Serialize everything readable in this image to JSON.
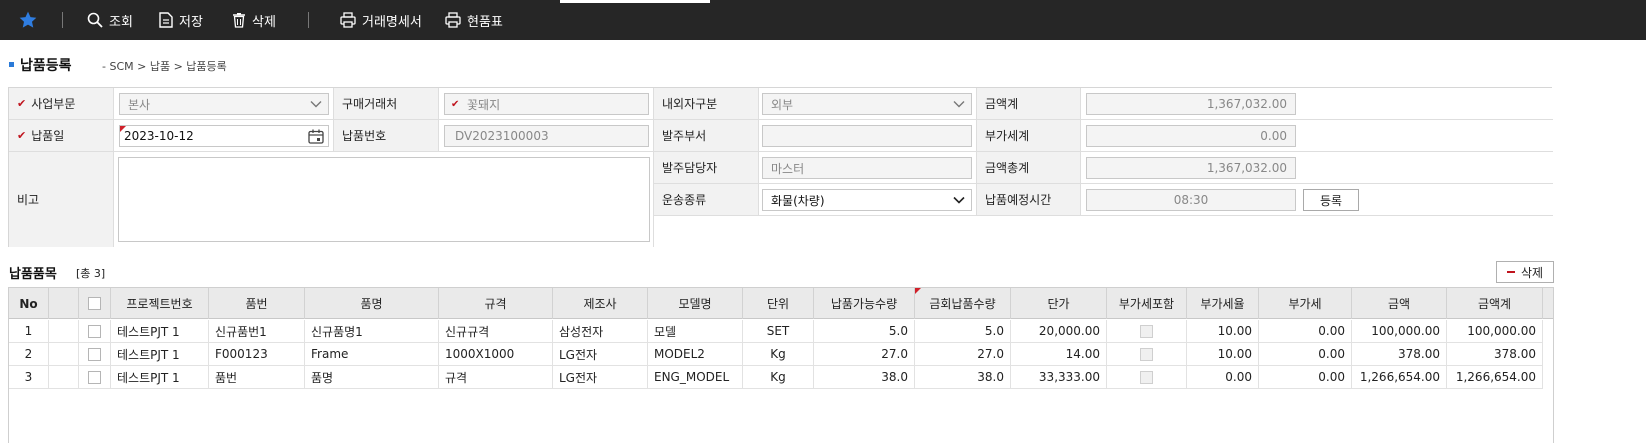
{
  "toolbar": {
    "items": [
      {
        "label": "조회",
        "icon": "search-icon"
      },
      {
        "label": "저장",
        "icon": "document-icon"
      },
      {
        "label": "삭제",
        "icon": "trash-icon"
      },
      {
        "label": "거래명세서",
        "icon": "printer-icon"
      },
      {
        "label": "현품표",
        "icon": "printer-icon"
      }
    ],
    "favorite_icon": "star-icon",
    "accent": "#1e6fd9"
  },
  "page": {
    "title": "납품등록",
    "breadcrumb": "- SCM > 납품 > 납품등록"
  },
  "form": {
    "business_unit": {
      "label": "사업부문",
      "value": "본사"
    },
    "purchase_partner": {
      "label": "구매거래처",
      "value": "꽃돼지"
    },
    "domestic_foreign": {
      "label": "내외자구분",
      "value": "외부"
    },
    "amount_sum": {
      "label": "금액계",
      "value": "1,367,032.00"
    },
    "delivery_date": {
      "label": "납품일",
      "value": "2023-10-12"
    },
    "delivery_no": {
      "label": "납품번호",
      "value": "DV2023100003"
    },
    "order_dept": {
      "label": "발주부서",
      "value": ""
    },
    "vat_sum": {
      "label": "부가세계",
      "value": "0.00"
    },
    "remarks": {
      "label": "비고",
      "value": ""
    },
    "order_manager": {
      "label": "발주담당자",
      "value": "마스터"
    },
    "total_amount": {
      "label": "금액총계",
      "value": "1,367,032.00"
    },
    "transport_type": {
      "label": "운송종류",
      "value": "화물(차량)"
    },
    "scheduled_time": {
      "label": "납품예정시간",
      "value": "08:30"
    },
    "register_button": "등록"
  },
  "items_section": {
    "title": "납품품목",
    "count": "[총 3]",
    "delete_button": "삭제"
  },
  "grid": {
    "columns": [
      "No",
      "",
      "",
      "프로젝트번호",
      "품번",
      "품명",
      "규격",
      "제조사",
      "모델명",
      "단위",
      "납품가능수량",
      "금회납품수량",
      "단가",
      "부가세포함",
      "부가세율",
      "부가세",
      "금액",
      "금액계"
    ],
    "rows": [
      {
        "no": "1",
        "project": "테스트PJT 1",
        "part_no": "신규품번1",
        "part_name": "신규품명1",
        "spec": "신규규격",
        "maker": "삼성전자",
        "model": "모델",
        "unit": "SET",
        "avail_qty": "5.0",
        "this_qty": "5.0",
        "price": "20,000.00",
        "vat_rate": "10.00",
        "vat": "0.00",
        "amount": "100,000.00",
        "amount_total": "100,000.00"
      },
      {
        "no": "2",
        "project": "테스트PJT 1",
        "part_no": "F000123",
        "part_name": "Frame",
        "spec": "1000X1000",
        "maker": "LG전자",
        "model": "MODEL2",
        "unit": "Kg",
        "avail_qty": "27.0",
        "this_qty": "27.0",
        "price": "14.00",
        "vat_rate": "10.00",
        "vat": "0.00",
        "amount": "378.00",
        "amount_total": "378.00"
      },
      {
        "no": "3",
        "project": "테스트PJT 1",
        "part_no": "품번",
        "part_name": "품명",
        "spec": "규격",
        "maker": "LG전자",
        "model": "ENG_MODEL",
        "unit": "Kg",
        "avail_qty": "38.0",
        "this_qty": "38.0",
        "price": "33,333.00",
        "vat_rate": "0.00",
        "vat": "0.00",
        "amount": "1,266,654.00",
        "amount_total": "1,266,654.00"
      }
    ]
  }
}
